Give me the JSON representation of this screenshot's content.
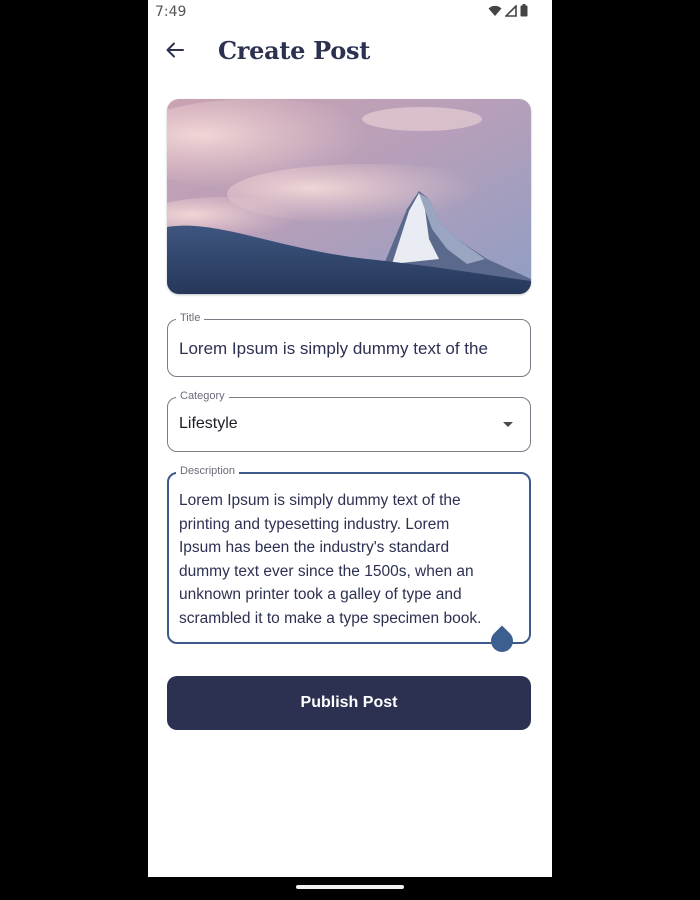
{
  "status_bar": {
    "time": "7:49",
    "icons": [
      "wifi-icon",
      "signal-icon",
      "battery-icon"
    ]
  },
  "app_bar": {
    "back_icon": "arrow-back-icon",
    "title": "Create Post"
  },
  "hero_image": {
    "description": "mountain-peak-photo"
  },
  "form": {
    "title": {
      "label": "Title",
      "value": "Lorem Ipsum is simply dummy text of the"
    },
    "category": {
      "label": "Category",
      "value": "Lifestyle"
    },
    "description": {
      "label": "Description",
      "value": "Lorem Ipsum is simply dummy text of the\nprinting and typesetting industry. Lorem\nIpsum has been the industry's standard\ndummy text ever since the 1500s, when an\nunknown printer took a galley of type and\nscrambled it to make a type specimen book."
    }
  },
  "publish_button": {
    "label": "Publish Post"
  },
  "colors": {
    "primary": "#2c3152",
    "focus_border": "#3d5a8a",
    "background": "#ffffff"
  }
}
